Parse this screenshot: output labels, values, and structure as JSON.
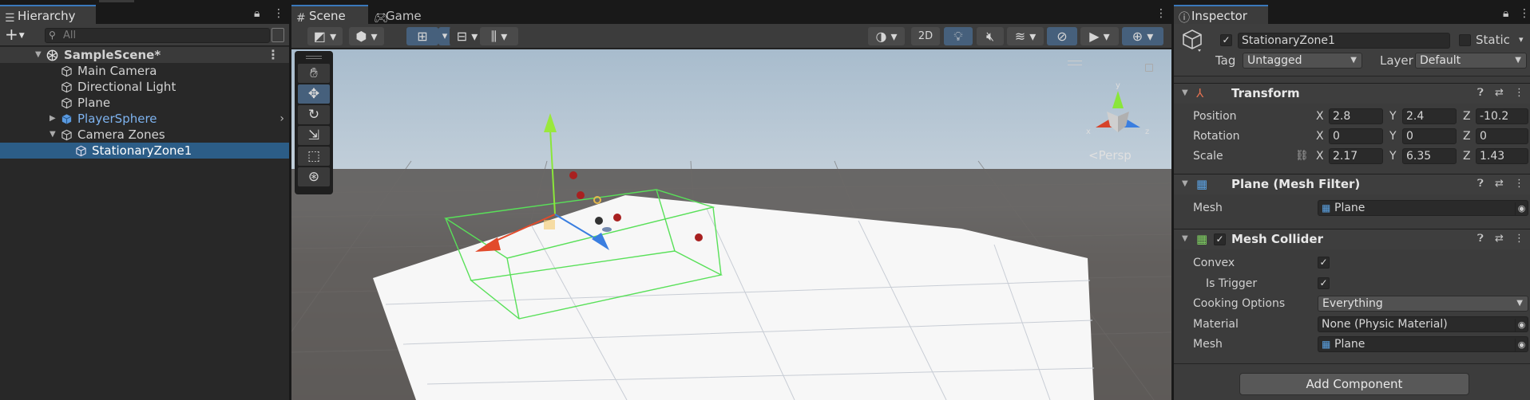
{
  "hierarchy": {
    "tab_label": "Hierarchy",
    "search_placeholder": "All",
    "add_label": "+",
    "items": [
      {
        "label": "SampleScene*"
      },
      {
        "label": "Main Camera"
      },
      {
        "label": "Directional Light"
      },
      {
        "label": "Plane"
      },
      {
        "label": "PlayerSphere"
      },
      {
        "label": "Camera Zones"
      },
      {
        "label": "StationaryZone1"
      }
    ]
  },
  "scene": {
    "tabs": [
      {
        "label": "Scene"
      },
      {
        "label": "Game"
      }
    ],
    "toggle_2d": "2D",
    "persp_label": "Persp",
    "gizmo_axes": {
      "x": "x",
      "y": "y",
      "z": "z"
    }
  },
  "inspector": {
    "tab_label": "Inspector",
    "object_name": "StationaryZone1",
    "static_label": "Static",
    "tag_label": "Tag",
    "tag_value": "Untagged",
    "layer_label": "Layer",
    "layer_value": "Default",
    "transform": {
      "title": "Transform",
      "position_label": "Position",
      "rotation_label": "Rotation",
      "scale_label": "Scale",
      "position": {
        "x": "2.8",
        "y": "2.4",
        "z": "-10.2"
      },
      "rotation": {
        "x": "0",
        "y": "0",
        "z": "0"
      },
      "scale": {
        "x": "2.17",
        "y": "6.35",
        "z": "1.43"
      }
    },
    "mesh_filter": {
      "title": "Plane (Mesh Filter)",
      "mesh_label": "Mesh",
      "mesh_value": "Plane"
    },
    "mesh_collider": {
      "title": "Mesh Collider",
      "convex_label": "Convex",
      "is_trigger_label": "Is Trigger",
      "cooking_label": "Cooking Options",
      "cooking_value": "Everything",
      "material_label": "Material",
      "material_value": "None (Physic Material)",
      "mesh_label": "Mesh",
      "mesh_value": "Plane"
    },
    "add_component": "Add Component"
  },
  "axis_labels": {
    "x": "X",
    "y": "Y",
    "z": "Z"
  },
  "colors": {
    "accent": "#3a79bb",
    "selection": "#2c5d87",
    "prefab_text": "#7eb3ef",
    "sky": "#bfd0de",
    "ground": "#5a5755"
  }
}
